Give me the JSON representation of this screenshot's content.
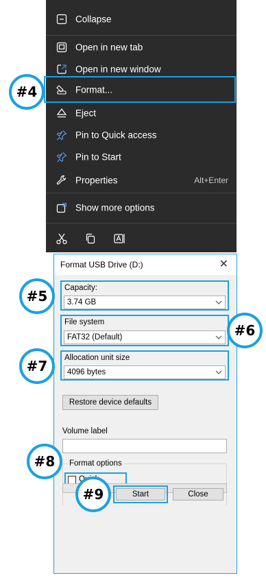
{
  "context_menu": {
    "items": [
      {
        "label": "Collapse",
        "icon": "collapse-icon"
      },
      {
        "label": "Open in new tab",
        "icon": "new-tab-icon"
      },
      {
        "label": "Open in new window",
        "icon": "new-window-icon"
      },
      {
        "label": "Format...",
        "icon": "format-icon"
      },
      {
        "label": "Eject",
        "icon": "eject-icon"
      },
      {
        "label": "Pin to Quick access",
        "icon": "pin-icon"
      },
      {
        "label": "Pin to Start",
        "icon": "pin-icon"
      },
      {
        "label": "Properties",
        "icon": "wrench-icon",
        "shortcut": "Alt+Enter"
      },
      {
        "label": "Show more options",
        "icon": "more-options-icon"
      }
    ],
    "bottom_icons": [
      "cut-icon",
      "copy-icon",
      "rename-icon"
    ]
  },
  "dialog": {
    "title": "Format USB Drive (D:)",
    "capacity_label": "Capacity:",
    "capacity_value": "3.74 GB",
    "filesystem_label": "File system",
    "filesystem_value": "FAT32 (Default)",
    "allocation_label": "Allocation unit size",
    "allocation_value": "4096 bytes",
    "restore_button": "Restore device defaults",
    "volume_label": "Volume label",
    "volume_value": "",
    "format_options_label": "Format options",
    "quick_format_label": "Quick Format",
    "quick_format_checked": false,
    "start_button": "Start",
    "close_button": "Close"
  },
  "badges": {
    "step4": "#4",
    "step5": "#5",
    "step6": "#6",
    "step7": "#7",
    "step8": "#8",
    "step9": "#9"
  },
  "colors": {
    "menu_bg": "#2b2b2b",
    "highlight": "#1ba1e2",
    "dialog_bg": "#f0f0f0"
  }
}
